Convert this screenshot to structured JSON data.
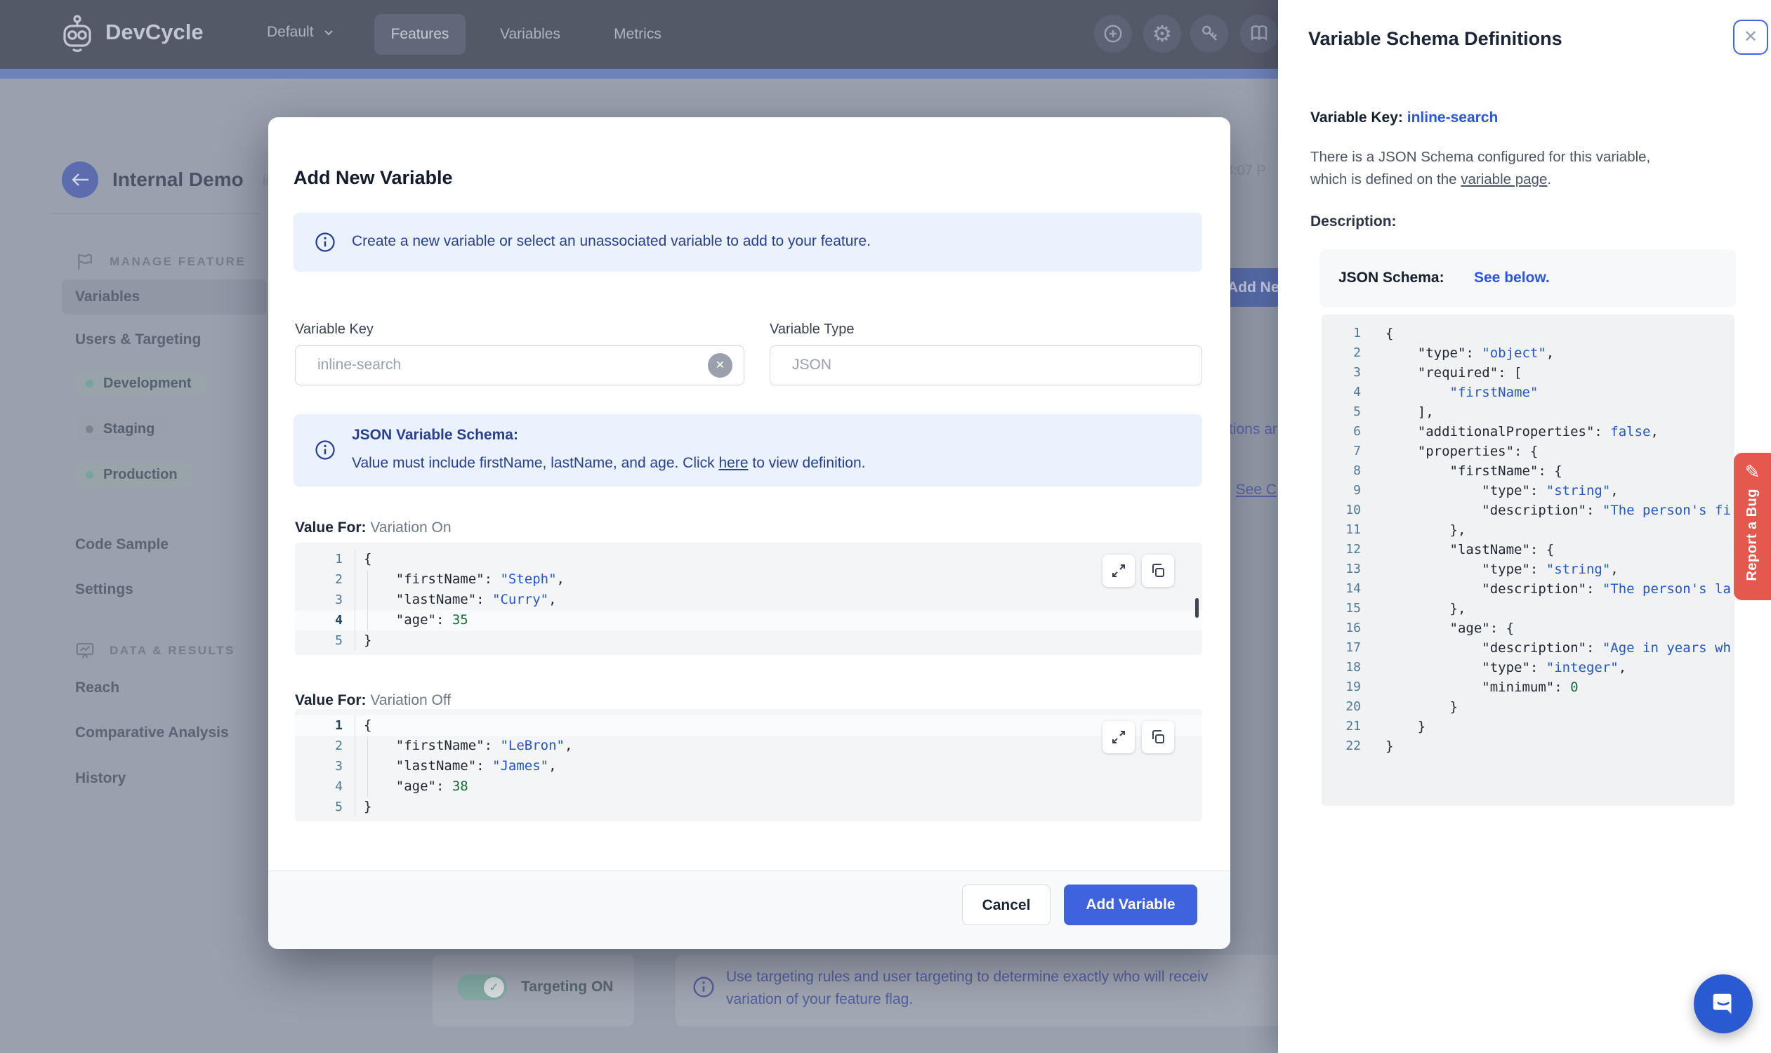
{
  "navbar": {
    "logo_text": "DevCycle",
    "org_label": "Default",
    "tabs": [
      {
        "label": "Features",
        "active": true
      },
      {
        "label": "Variables",
        "active": false
      },
      {
        "label": "Metrics",
        "active": false
      }
    ],
    "icons": [
      "plus-circle",
      "gear",
      "key",
      "book"
    ]
  },
  "sidebar": {
    "title": "Internal Demo",
    "title_suffix_fragment": "in",
    "section1_header": "MANAGE FEATURE",
    "items": [
      {
        "label": "Variables",
        "active": true
      },
      {
        "label": "Users & Targeting",
        "active": false
      }
    ],
    "environments": [
      {
        "label": "Development",
        "dot_color": "#76a49d"
      },
      {
        "label": "Staging",
        "dot_color": "#7d8391"
      },
      {
        "label": "Production",
        "dot_color": "#76a49d"
      }
    ],
    "items2": [
      {
        "label": "Code Sample"
      },
      {
        "label": "Settings"
      }
    ],
    "section2_header": "DATA & RESULTS",
    "items3": [
      {
        "label": "Reach"
      },
      {
        "label": "Comparative Analysis"
      },
      {
        "label": "History"
      }
    ]
  },
  "background": {
    "timestamp_fragment": "3:07 P",
    "add_new_button_fragment": "Add Ne",
    "blue_text_fragment_1": "tions ar",
    "blue_text_fragment_2_prefix": ". ",
    "blue_text_fragment_2_link": "See C",
    "targeting_toggle_label": "Targeting ON",
    "targeting_info_line1": "Use targeting rules and user targeting to determine exactly who will receiv",
    "targeting_info_line2": "variation of your feature flag."
  },
  "modal": {
    "title": "Add New Variable",
    "info_banner": "Create a new variable or select an unassociated variable to add to your feature.",
    "fields": {
      "key_label": "Variable Key",
      "key_value": "inline-search",
      "type_label": "Variable Type",
      "type_value": "JSON"
    },
    "schema_banner": {
      "title": "JSON Variable Schema:",
      "body_before_link": "Value must include firstName, lastName, and age. Click ",
      "link": "here",
      "body_after_link": " to view definition."
    },
    "variation_on": {
      "label_prefix": "Value For: ",
      "label": "Variation On",
      "active_line": 4,
      "lines": [
        [
          [
            "t",
            "{"
          ]
        ],
        [
          [
            "t",
            "    \"firstName\": "
          ],
          [
            "s",
            "\"Steph\""
          ],
          [
            "t",
            ","
          ]
        ],
        [
          [
            "t",
            "    \"lastName\": "
          ],
          [
            "s",
            "\"Curry\""
          ],
          [
            "t",
            ","
          ]
        ],
        [
          [
            "t",
            "    \"age\": "
          ],
          [
            "n",
            "35"
          ]
        ],
        [
          [
            "t",
            "}"
          ]
        ]
      ]
    },
    "variation_off": {
      "label_prefix": "Value For: ",
      "label": "Variation Off",
      "active_line": 1,
      "lines": [
        [
          [
            "t",
            "{"
          ]
        ],
        [
          [
            "t",
            "    \"firstName\": "
          ],
          [
            "s",
            "\"LeBron\""
          ],
          [
            "t",
            ","
          ]
        ],
        [
          [
            "t",
            "    \"lastName\": "
          ],
          [
            "s",
            "\"James\""
          ],
          [
            "t",
            ","
          ]
        ],
        [
          [
            "t",
            "    \"age\": "
          ],
          [
            "n",
            "38"
          ]
        ],
        [
          [
            "t",
            "}"
          ]
        ]
      ]
    },
    "footer": {
      "cancel": "Cancel",
      "submit": "Add Variable"
    }
  },
  "panel": {
    "title": "Variable Schema Definitions",
    "key_label": "Variable Key: ",
    "key_value": "inline-search",
    "para_line1": "There is a JSON Schema configured for this variable,",
    "para_line2_before": "which is defined on the ",
    "para_line2_link": "variable page",
    "para_line2_after": ".",
    "description_label": "Description:",
    "schema_label": "JSON Schema:",
    "schema_link": "See below.",
    "code": {
      "active_line": 0,
      "lines": [
        [
          [
            "t",
            "{"
          ]
        ],
        [
          [
            "t",
            "    \"type\": "
          ],
          [
            "s",
            "\"object\""
          ],
          [
            "t",
            ","
          ]
        ],
        [
          [
            "t",
            "    \"required\": ["
          ]
        ],
        [
          [
            "t",
            "        "
          ],
          [
            "s",
            "\"firstName\""
          ]
        ],
        [
          [
            "t",
            "    ],"
          ]
        ],
        [
          [
            "t",
            "    \"additionalProperties\": "
          ],
          [
            "s",
            "false"
          ],
          [
            "t",
            ","
          ]
        ],
        [
          [
            "t",
            "    \"properties\": {"
          ]
        ],
        [
          [
            "t",
            "        \"firstName\": {"
          ]
        ],
        [
          [
            "t",
            "            \"type\": "
          ],
          [
            "s",
            "\"string\""
          ],
          [
            "t",
            ","
          ]
        ],
        [
          [
            "t",
            "            \"description\": "
          ],
          [
            "s",
            "\"The person's fi"
          ]
        ],
        [
          [
            "t",
            "        },"
          ]
        ],
        [
          [
            "t",
            "        \"lastName\": {"
          ]
        ],
        [
          [
            "t",
            "            \"type\": "
          ],
          [
            "s",
            "\"string\""
          ],
          [
            "t",
            ","
          ]
        ],
        [
          [
            "t",
            "            \"description\": "
          ],
          [
            "s",
            "\"The person's la"
          ]
        ],
        [
          [
            "t",
            "        },"
          ]
        ],
        [
          [
            "t",
            "        \"age\": {"
          ]
        ],
        [
          [
            "t",
            "            \"description\": "
          ],
          [
            "s",
            "\"Age in years wh"
          ]
        ],
        [
          [
            "t",
            "            \"type\": "
          ],
          [
            "s",
            "\"integer\""
          ],
          [
            "t",
            ","
          ]
        ],
        [
          [
            "t",
            "            \"minimum\": "
          ],
          [
            "n",
            "0"
          ]
        ],
        [
          [
            "t",
            "        }"
          ]
        ],
        [
          [
            "t",
            "    }"
          ]
        ],
        [
          [
            "t",
            "}"
          ]
        ]
      ]
    }
  },
  "report_bug_label": "Report a Bug",
  "colors": {
    "accent_blue": "#3e63dd",
    "link_blue": "#2b55e2",
    "banner_strip": "#6d81ba",
    "bug_tab_red": "#e4584e",
    "toggle_teal": "#85aca6",
    "navbar_dimmed": "#545968",
    "page_dimmed": "#9aa0ad"
  }
}
